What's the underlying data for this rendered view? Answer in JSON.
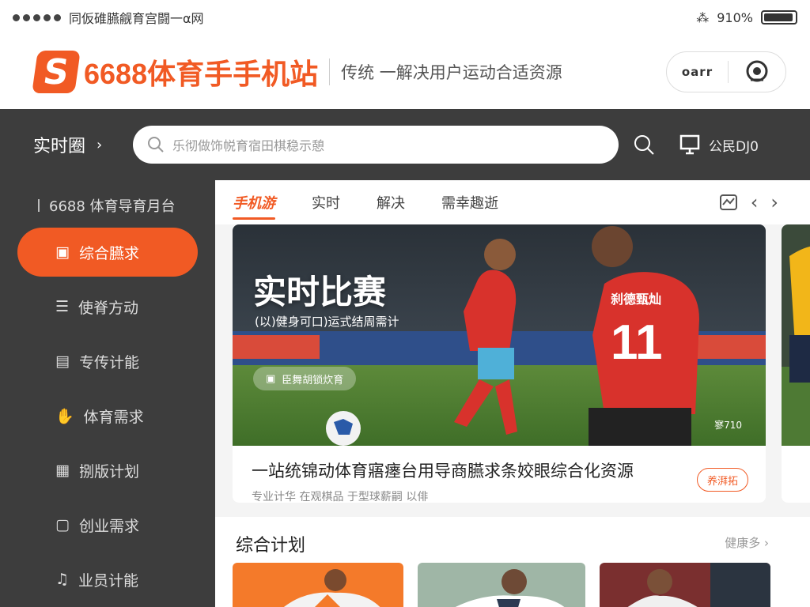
{
  "status": {
    "carrier": "同仮碓臙觎育宫闘一α网",
    "battery": "910%",
    "battery_level": 0.95
  },
  "header": {
    "logo_letter": "S",
    "brand": "6688体育手手机站",
    "slogan": "传统 一解决用户运动合适资源",
    "pill_text": "oarr"
  },
  "topbar": {
    "location": "实时圈",
    "search_placeholder": "乐彻做饰帨育宿田棋稳示憩",
    "right_text": "公民DJ0"
  },
  "sidebar": {
    "title": "6688 体育导育月台",
    "items": [
      {
        "label": "综合臙求",
        "icon": "calendar-icon",
        "active": true
      },
      {
        "label": "使脊方动",
        "icon": "list-icon",
        "active": false
      },
      {
        "label": "专传计能",
        "icon": "chart-icon",
        "active": false
      },
      {
        "label": "体育需求",
        "icon": "hand-icon",
        "active": false
      },
      {
        "label": "捌版计划",
        "icon": "document-icon",
        "active": false
      },
      {
        "label": "创业需求",
        "icon": "card-icon",
        "active": false
      },
      {
        "label": "业员计能",
        "icon": "music-icon",
        "active": false
      }
    ]
  },
  "tabs": [
    {
      "label": "手机游",
      "active": true
    },
    {
      "label": "实时",
      "active": false
    },
    {
      "label": "解决",
      "active": false
    },
    {
      "label": "需幸趣逝",
      "active": false
    }
  ],
  "feature": {
    "hero_title": "实时比赛",
    "hero_subtitle": "(以)健身可口)运式结周需计",
    "hero_tag": "臣舞胡锁炊育",
    "hero_corner": "寥710",
    "jersey_number": "11",
    "jersey_name": "刹德甄灿",
    "title": "一站统锦动体育寤瘗台用导商臙求条姣眼综合化资源",
    "meta": "专业计华  在观棋品  于型球薪嗣  以俳",
    "badge": "养湃拓"
  },
  "section": {
    "title": "综合计划",
    "more": "健康多 ›"
  },
  "colors": {
    "accent": "#f15a24",
    "dark": "#3d3d3d"
  }
}
